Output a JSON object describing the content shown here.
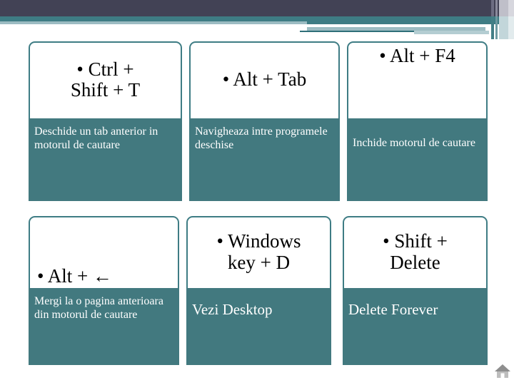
{
  "slide": {
    "background_color": "#ffffff",
    "banner": {
      "navy_color": "#424255",
      "teal_color": "#3e7c84",
      "light_color": "#9cbcc2"
    },
    "accent_color": "#42797f",
    "cards": [
      {
        "shortcut": "• Ctrl +\nShift + T",
        "description": "Deschide un tab anterior in motorul de cautare",
        "head_align": "center",
        "body_size": "small"
      },
      {
        "shortcut": "• Alt + Tab",
        "description": "Navigheaza intre programele deschise",
        "head_align": "center",
        "body_size": "small"
      },
      {
        "shortcut": "• Alt + F4",
        "description": "Inchide motorul de cautare",
        "head_align": "top",
        "body_size": "small"
      },
      {
        "shortcut": "• Alt + ←",
        "description": "Mergi la o pagina anterioara din motorul de cautare",
        "head_align": "bottom",
        "body_size": "small"
      },
      {
        "shortcut": "• Windows\nkey + D",
        "description": "Vezi Desktop",
        "head_align": "center",
        "body_size": "large"
      },
      {
        "shortcut": "• Shift +\nDelete",
        "description": "Delete Forever",
        "head_align": "center",
        "body_size": "large"
      }
    ],
    "home_icon": "home-icon"
  }
}
